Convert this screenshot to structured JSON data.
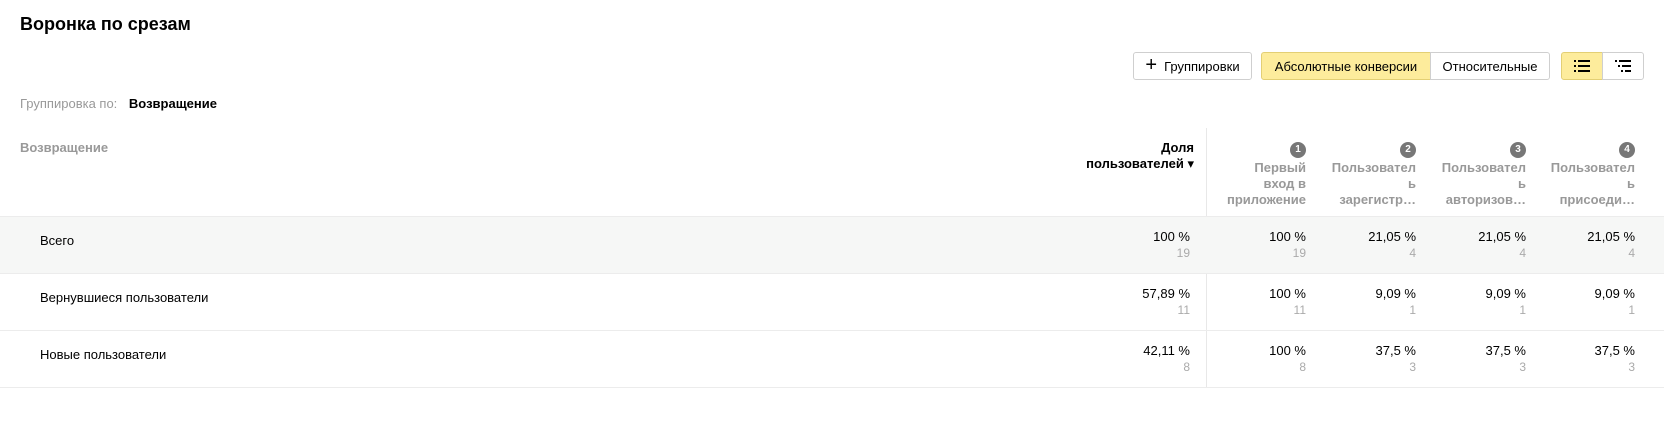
{
  "page": {
    "title": "Воронка по срезам"
  },
  "toolbar": {
    "groupings_label": "Группировки",
    "abs_label": "Абсолютные конверсии",
    "rel_label": "Относительные",
    "list_icon": "list-view-icon",
    "tree_icon": "tree-view-icon"
  },
  "grouping": {
    "label": "Группировка по:",
    "value": "Возвращение"
  },
  "table": {
    "dim_header": "Возвращение",
    "share_header": "Доля пользователей ▾",
    "steps": [
      {
        "num": "1",
        "name": "Первый\nвход в\nприложение"
      },
      {
        "num": "2",
        "name": "Пользовател\nь\nзарегистр…"
      },
      {
        "num": "3",
        "name": "Пользовател\nь\nавторизов…"
      },
      {
        "num": "4",
        "name": "Пользовател\nь\nприсоеди…"
      }
    ],
    "rows": [
      {
        "name": "Всего",
        "share": "100 %",
        "share_count": "19",
        "steps": [
          {
            "pct": "100 %",
            "count": "19"
          },
          {
            "pct": "21,05 %",
            "count": "4"
          },
          {
            "pct": "21,05 %",
            "count": "4"
          },
          {
            "pct": "21,05 %",
            "count": "4"
          }
        ]
      },
      {
        "name": "Вернувшиеся пользователи",
        "share": "57,89 %",
        "share_count": "11",
        "steps": [
          {
            "pct": "100 %",
            "count": "11"
          },
          {
            "pct": "9,09 %",
            "count": "1"
          },
          {
            "pct": "9,09 %",
            "count": "1"
          },
          {
            "pct": "9,09 %",
            "count": "1"
          }
        ]
      },
      {
        "name": "Новые пользователи",
        "share": "42,11 %",
        "share_count": "8",
        "steps": [
          {
            "pct": "100 %",
            "count": "8"
          },
          {
            "pct": "37,5 %",
            "count": "3"
          },
          {
            "pct": "37,5 %",
            "count": "3"
          },
          {
            "pct": "37,5 %",
            "count": "3"
          }
        ]
      }
    ]
  }
}
